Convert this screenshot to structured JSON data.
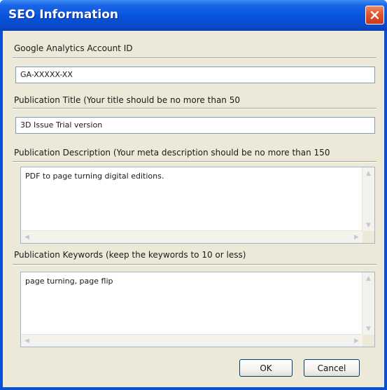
{
  "window": {
    "title": "SEO Information"
  },
  "icons": {
    "close": "close-icon",
    "arrow_up": "arrow-up-icon",
    "arrow_down": "arrow-down-icon",
    "arrow_left": "arrow-left-icon",
    "arrow_right": "arrow-right-icon"
  },
  "colors": {
    "titlebar": "#0653dc",
    "close_button": "#e3552d",
    "client_bg": "#ece9d8",
    "field_border": "#7f9db9"
  },
  "fields": {
    "analytics_id": {
      "label": "Google Analytics Account ID",
      "value": "GA-XXXXX-XX"
    },
    "title": {
      "label": "Publication Title (Your title should be no more than 50",
      "value": "3D Issue Trial version"
    },
    "description": {
      "label": "Publication Description (Your meta description should be no more than 150",
      "value": "PDF to page turning digital editions."
    },
    "keywords": {
      "label": "Publication Keywords (keep the keywords to 10 or less)",
      "value": "page turning, page flip"
    }
  },
  "buttons": {
    "ok": "OK",
    "cancel": "Cancel"
  }
}
